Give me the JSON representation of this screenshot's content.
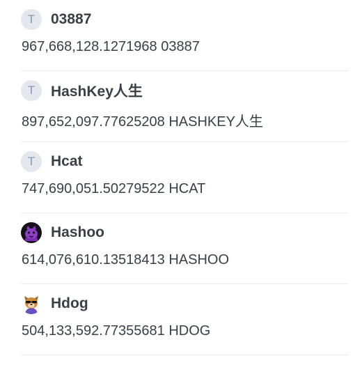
{
  "tokens": [
    {
      "avatar_letter": "T",
      "avatar_icon": "letter-avatar-icon",
      "name": "03887",
      "amount": "967,668,128.1271968 03887"
    },
    {
      "avatar_letter": "T",
      "avatar_icon": "letter-avatar-icon",
      "name": "HashKey人生",
      "amount": "897,652,097.77625208 HASHKEY人生"
    },
    {
      "avatar_letter": "T",
      "avatar_icon": "letter-avatar-icon",
      "name": "Hcat",
      "amount": "747,690,051.50279522 HCAT"
    },
    {
      "avatar_icon": "purple-creature-icon",
      "name": "Hashoo",
      "amount": "614,076,610.13518413 HASHOO"
    },
    {
      "avatar_icon": "dog-with-sunglasses-icon",
      "name": "Hdog",
      "amount": "504,133,592.77355681 HDOG"
    }
  ],
  "colors": {
    "text": "#3a3f47",
    "divider": "#ececec",
    "letter_avatar_bg": "#e3e8ef",
    "letter_avatar_fg": "#8b96a8",
    "hashoo_avatar_bg": "#16121c",
    "hashoo_creature": "#8e3fc7",
    "hdog_fur": "#c98a3e"
  }
}
